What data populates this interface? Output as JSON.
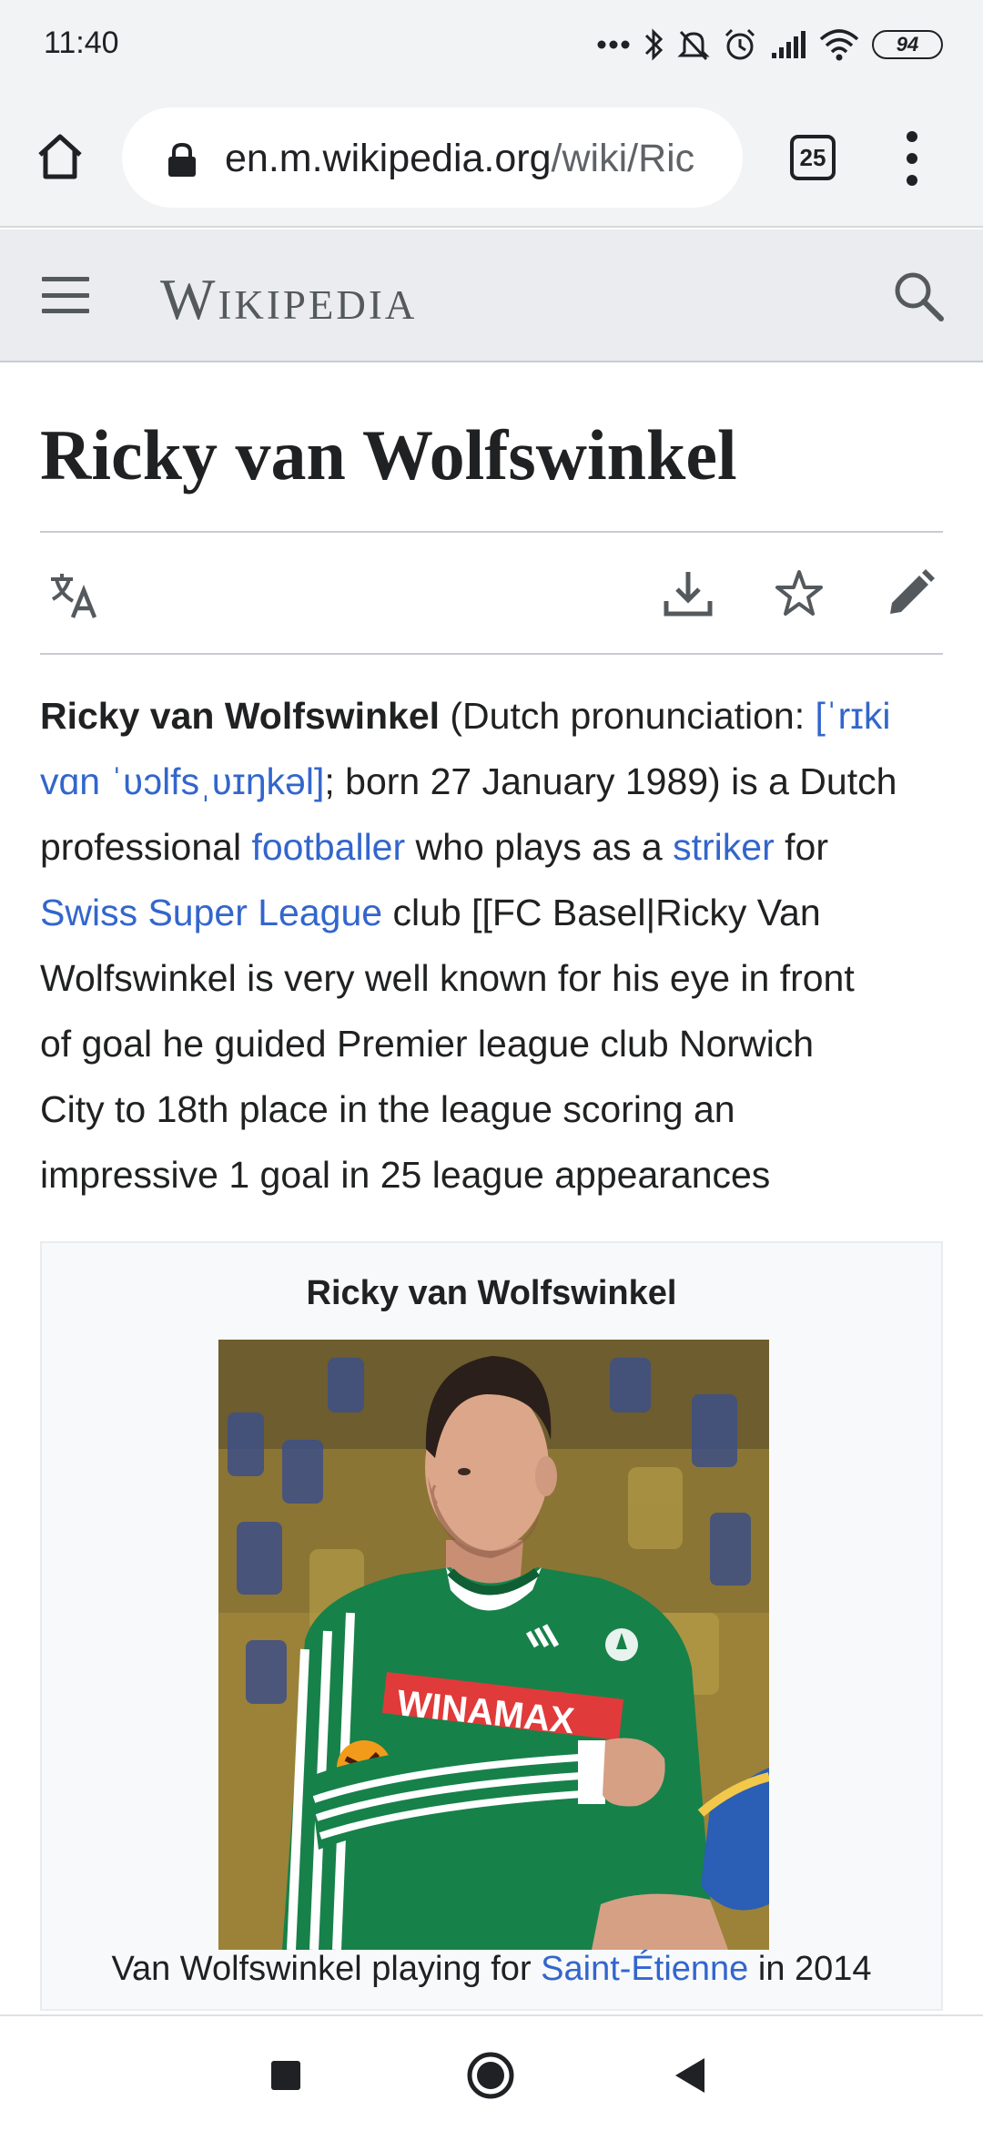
{
  "status_bar": {
    "time": "11:40",
    "battery": "94"
  },
  "browser": {
    "url_host": "en.m.wikipedia.org",
    "url_path": "/wiki/Ric",
    "tab_count": "25"
  },
  "wiki_header": {
    "wordmark": "Wikipedia"
  },
  "article": {
    "title": "Ricky van Wolfswinkel",
    "lead": {
      "subject": "Ricky van Wolfswinkel",
      "t1": " (Dutch pronunciation: ",
      "ipa1": "[ˈrɪki",
      "ipa2": "vɑn ˈʋɔlfsˌʋɪŋkəl]",
      "t2": "; born 27 January 1989) is a Dutch",
      "t3": "professional ",
      "link_footballer": "footballer",
      "t4": " who plays as a ",
      "link_striker": "striker",
      "t5": " for",
      "link_league": "Swiss Super League",
      "t6": " club [[FC Basel|Ricky Van",
      "t7": "Wolfswinkel is very well known for his eye in front",
      "t8": "of goal he guided Premier league club Norwich",
      "t9": "City to 18th place in the league scoring an",
      "t10": "impressive 1 goal in 25 league appearances"
    },
    "infobox": {
      "title": "Ricky van Wolfswinkel",
      "caption_pre": "Van Wolfswinkel playing for ",
      "caption_link": "Saint-Étienne",
      "caption_post": " in 2014",
      "shirt_text": "WINAMAX"
    }
  },
  "colors": {
    "link": "#3366cc",
    "chrome_bg": "#f1f3f4",
    "wiki_header_bg": "#eaecf0",
    "shirt_green": "#17814a"
  },
  "icons": [
    "home-icon",
    "lock-icon",
    "tabs-icon",
    "menu-icon",
    "hamburger-icon",
    "search-icon",
    "translate-icon",
    "download-icon",
    "star-icon",
    "edit-icon",
    "stop-icon",
    "home-circle-icon",
    "back-icon"
  ]
}
